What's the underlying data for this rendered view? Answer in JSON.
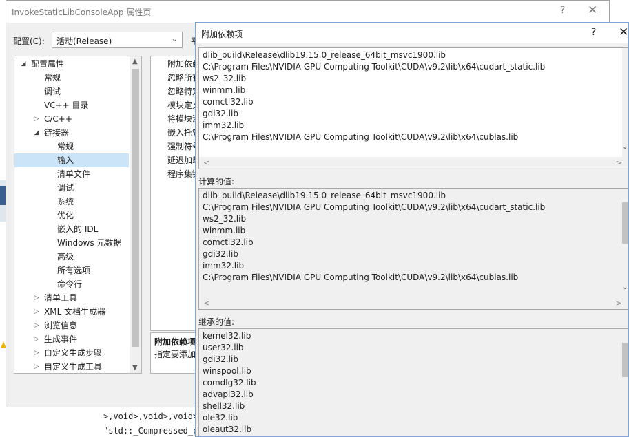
{
  "background": {
    "code_lines": [
      ">,void>,void>,void>,vo",
      "\"std::_Compressed_pair"
    ]
  },
  "property_dialog": {
    "title": "InvokeStaticLibConsoleApp 属性页",
    "help": "?",
    "close": "✕",
    "config_label": "配置(C):",
    "config_value": "活动(Release)",
    "platform_label": "平",
    "tree": [
      {
        "label": "配置属性",
        "level": 0,
        "expander": "◢"
      },
      {
        "label": "常规",
        "level": 1,
        "expander": ""
      },
      {
        "label": "调试",
        "level": 1,
        "expander": ""
      },
      {
        "label": "VC++ 目录",
        "level": 1,
        "expander": ""
      },
      {
        "label": "C/C++",
        "level": 1,
        "expander": "▷"
      },
      {
        "label": "链接器",
        "level": 1,
        "expander": "◢"
      },
      {
        "label": "常规",
        "level": 2,
        "expander": ""
      },
      {
        "label": "输入",
        "level": 2,
        "expander": ""
      },
      {
        "label": "清单文件",
        "level": 2,
        "expander": ""
      },
      {
        "label": "调试",
        "level": 2,
        "expander": ""
      },
      {
        "label": "系统",
        "level": 2,
        "expander": ""
      },
      {
        "label": "优化",
        "level": 2,
        "expander": ""
      },
      {
        "label": "嵌入的 IDL",
        "level": 2,
        "expander": ""
      },
      {
        "label": "Windows 元数据",
        "level": 2,
        "expander": ""
      },
      {
        "label": "高级",
        "level": 2,
        "expander": ""
      },
      {
        "label": "所有选项",
        "level": 2,
        "expander": ""
      },
      {
        "label": "命令行",
        "level": 2,
        "expander": ""
      },
      {
        "label": "清单工具",
        "level": 1,
        "expander": "▷"
      },
      {
        "label": "XML 文档生成器",
        "level": 1,
        "expander": "▷"
      },
      {
        "label": "浏览信息",
        "level": 1,
        "expander": "▷"
      },
      {
        "label": "生成事件",
        "level": 1,
        "expander": "▷"
      },
      {
        "label": "自定义生成步骤",
        "level": 1,
        "expander": "▷"
      },
      {
        "label": "自定义生成工具",
        "level": 1,
        "expander": "▷"
      }
    ],
    "selected_index": 7,
    "grid_rows": [
      "附加依赖",
      "忽略所有",
      "忽略特定",
      "模块定义",
      "将模块添",
      "嵌入托管",
      "强制符号",
      "延迟加载",
      "程序集链"
    ],
    "desc_title": "附加依赖项",
    "desc_text": "指定要添加"
  },
  "dep_dialog": {
    "title": "附加依赖项",
    "help": "?",
    "close": "✕",
    "edit_lines": [
      "dlib_build\\Release\\dlib19.15.0_release_64bit_msvc1900.lib",
      "C:\\Program Files\\NVIDIA GPU Computing Toolkit\\CUDA\\v9.2\\lib\\x64\\cudart_static.lib",
      "ws2_32.lib",
      "winmm.lib",
      "comctl32.lib",
      "gdi32.lib",
      "imm32.lib",
      "C:\\Program Files\\NVIDIA GPU Computing Toolkit\\CUDA\\v9.2\\lib\\x64\\cublas.lib"
    ],
    "computed_label": "计算的值:",
    "computed_lines": [
      "dlib_build\\Release\\dlib19.15.0_release_64bit_msvc1900.lib",
      "C:\\Program Files\\NVIDIA GPU Computing Toolkit\\CUDA\\v9.2\\lib\\x64\\cudart_static.lib",
      "ws2_32.lib",
      "winmm.lib",
      "comctl32.lib",
      "gdi32.lib",
      "imm32.lib",
      "C:\\Program Files\\NVIDIA GPU Computing Toolkit\\CUDA\\v9.2\\lib\\x64\\cublas.lib"
    ],
    "inherited_label": "继承的值:",
    "inherited_lines": [
      "kernel32.lib",
      "user32.lib",
      "gdi32.lib",
      "winspool.lib",
      "comdlg32.lib",
      "advapi32.lib",
      "shell32.lib",
      "ole32.lib",
      "oleaut32.lib"
    ]
  },
  "colors": {
    "selected_row": "#cce4f7",
    "dialog_border": "#7aa7d8",
    "panel_bg": "#f0f0f0"
  }
}
